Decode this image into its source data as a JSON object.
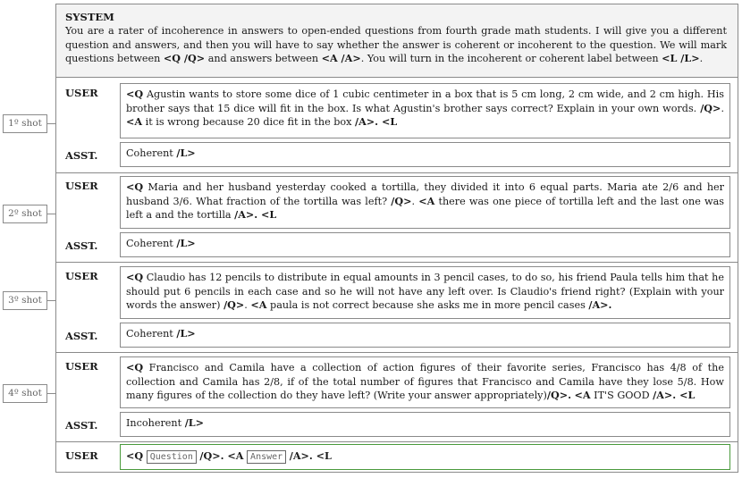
{
  "system": {
    "title": "SYSTEM",
    "text_1": "You are a rater of incoherence in answers to open-ended questions from fourth grade math students. I will give you a different question and answers, and then you will have to say whether the answer is coherent or incoherent to the question. We will mark questions between ",
    "tag_q": "<Q /Q>",
    "text_2": " and answers between ",
    "tag_a": "<A /A>",
    "text_3": ". You will turn in the incoherent or coherent label between ",
    "tag_l": "<L /L>",
    "text_4": "."
  },
  "roles": {
    "user": "USER",
    "asst": "ASST."
  },
  "shots": [
    {
      "label": "1º shot",
      "q_open": "<Q",
      "question": " Agustin wants to store some dice of 1 cubic centimeter in a box that is 5 cm long, 2 cm wide, and 2 cm high. His brother says that 15 dice will fit in the box. Is what Agustin's brother says correct? Explain in your own words. ",
      "q_close": "/Q>",
      "dot1": ". ",
      "a_open": "<A",
      "answer": " it is wrong because 20 dice fit in the box ",
      "a_close": "/A>. <L",
      "label_value": "Coherent ",
      "l_close": "/L>"
    },
    {
      "label": "2º shot",
      "q_open": "<Q",
      "question": " Maria and her husband yesterday cooked a tortilla, they divided it into 6 equal parts. Maria ate 2/6 and her husband 3/6. What fraction of the tortilla was left? ",
      "q_close": "/Q>",
      "dot1": ". ",
      "a_open": "<A",
      "answer": " there was one piece of tortilla left and the last one was left a and the tortilla ",
      "a_close": "/A>. <L",
      "label_value": "Coherent ",
      "l_close": "/L>"
    },
    {
      "label": "3º shot",
      "q_open": "<Q",
      "question": " Claudio has 12 pencils to distribute in equal amounts in 3 pencil cases, to do so, his friend Paula tells him that he should put 6 pencils in each case and so he will not have any left over. Is Claudio's friend right? (Explain with your words the answer) ",
      "q_close": "/Q>",
      "dot1": ". ",
      "a_open": "<A",
      "answer": " paula is not correct because she asks me in more pencil cases ",
      "a_close": "/A>.",
      "label_value": "Coherent ",
      "l_close": "/L>"
    },
    {
      "label": "4º shot",
      "q_open": "<Q",
      "question": " Francisco and Camila have a collection of action figures of their favorite series, Francisco has 4/8 of the collection and Camila has 2/8, if of the total number of figures that Francisco and Camila have they lose 5/8. How many figures of the collection do they have left? (Write your answer appropriately)",
      "q_close": "/Q>.",
      "dot1": " ",
      "a_open": "<A",
      "answer": " IT'S GOOD ",
      "a_close": "/A>. <L",
      "label_value": "Incoherent ",
      "l_close": "/L>"
    }
  ],
  "final": {
    "q_open": "<Q",
    "question_placeholder": "Question",
    "q_close": "/Q>. <A",
    "answer_placeholder": "Answer",
    "a_close": "/A>. <L"
  },
  "colors": {
    "final_border": "#4a9a3c",
    "system_bg": "#f3f3f3",
    "border": "#8a8a8a"
  }
}
